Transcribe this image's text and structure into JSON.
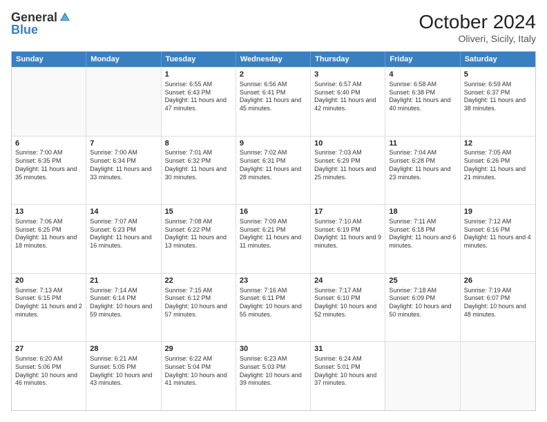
{
  "header": {
    "logo_general": "General",
    "logo_blue": "Blue",
    "month_title": "October 2024",
    "location": "Oliveri, Sicily, Italy"
  },
  "weekdays": [
    "Sunday",
    "Monday",
    "Tuesday",
    "Wednesday",
    "Thursday",
    "Friday",
    "Saturday"
  ],
  "weeks": [
    [
      {
        "day": "",
        "sunrise": "",
        "sunset": "",
        "daylight": ""
      },
      {
        "day": "",
        "sunrise": "",
        "sunset": "",
        "daylight": ""
      },
      {
        "day": "1",
        "sunrise": "Sunrise: 6:55 AM",
        "sunset": "Sunset: 6:43 PM",
        "daylight": "Daylight: 11 hours and 47 minutes."
      },
      {
        "day": "2",
        "sunrise": "Sunrise: 6:56 AM",
        "sunset": "Sunset: 6:41 PM",
        "daylight": "Daylight: 11 hours and 45 minutes."
      },
      {
        "day": "3",
        "sunrise": "Sunrise: 6:57 AM",
        "sunset": "Sunset: 6:40 PM",
        "daylight": "Daylight: 11 hours and 42 minutes."
      },
      {
        "day": "4",
        "sunrise": "Sunrise: 6:58 AM",
        "sunset": "Sunset: 6:38 PM",
        "daylight": "Daylight: 11 hours and 40 minutes."
      },
      {
        "day": "5",
        "sunrise": "Sunrise: 6:59 AM",
        "sunset": "Sunset: 6:37 PM",
        "daylight": "Daylight: 11 hours and 38 minutes."
      }
    ],
    [
      {
        "day": "6",
        "sunrise": "Sunrise: 7:00 AM",
        "sunset": "Sunset: 6:35 PM",
        "daylight": "Daylight: 11 hours and 35 minutes."
      },
      {
        "day": "7",
        "sunrise": "Sunrise: 7:00 AM",
        "sunset": "Sunset: 6:34 PM",
        "daylight": "Daylight: 11 hours and 33 minutes."
      },
      {
        "day": "8",
        "sunrise": "Sunrise: 7:01 AM",
        "sunset": "Sunset: 6:32 PM",
        "daylight": "Daylight: 11 hours and 30 minutes."
      },
      {
        "day": "9",
        "sunrise": "Sunrise: 7:02 AM",
        "sunset": "Sunset: 6:31 PM",
        "daylight": "Daylight: 11 hours and 28 minutes."
      },
      {
        "day": "10",
        "sunrise": "Sunrise: 7:03 AM",
        "sunset": "Sunset: 6:29 PM",
        "daylight": "Daylight: 11 hours and 25 minutes."
      },
      {
        "day": "11",
        "sunrise": "Sunrise: 7:04 AM",
        "sunset": "Sunset: 6:28 PM",
        "daylight": "Daylight: 11 hours and 23 minutes."
      },
      {
        "day": "12",
        "sunrise": "Sunrise: 7:05 AM",
        "sunset": "Sunset: 6:26 PM",
        "daylight": "Daylight: 11 hours and 21 minutes."
      }
    ],
    [
      {
        "day": "13",
        "sunrise": "Sunrise: 7:06 AM",
        "sunset": "Sunset: 6:25 PM",
        "daylight": "Daylight: 11 hours and 18 minutes."
      },
      {
        "day": "14",
        "sunrise": "Sunrise: 7:07 AM",
        "sunset": "Sunset: 6:23 PM",
        "daylight": "Daylight: 11 hours and 16 minutes."
      },
      {
        "day": "15",
        "sunrise": "Sunrise: 7:08 AM",
        "sunset": "Sunset: 6:22 PM",
        "daylight": "Daylight: 11 hours and 13 minutes."
      },
      {
        "day": "16",
        "sunrise": "Sunrise: 7:09 AM",
        "sunset": "Sunset: 6:21 PM",
        "daylight": "Daylight: 11 hours and 11 minutes."
      },
      {
        "day": "17",
        "sunrise": "Sunrise: 7:10 AM",
        "sunset": "Sunset: 6:19 PM",
        "daylight": "Daylight: 11 hours and 9 minutes."
      },
      {
        "day": "18",
        "sunrise": "Sunrise: 7:11 AM",
        "sunset": "Sunset: 6:18 PM",
        "daylight": "Daylight: 11 hours and 6 minutes."
      },
      {
        "day": "19",
        "sunrise": "Sunrise: 7:12 AM",
        "sunset": "Sunset: 6:16 PM",
        "daylight": "Daylight: 11 hours and 4 minutes."
      }
    ],
    [
      {
        "day": "20",
        "sunrise": "Sunrise: 7:13 AM",
        "sunset": "Sunset: 6:15 PM",
        "daylight": "Daylight: 11 hours and 2 minutes."
      },
      {
        "day": "21",
        "sunrise": "Sunrise: 7:14 AM",
        "sunset": "Sunset: 6:14 PM",
        "daylight": "Daylight: 10 hours and 59 minutes."
      },
      {
        "day": "22",
        "sunrise": "Sunrise: 7:15 AM",
        "sunset": "Sunset: 6:12 PM",
        "daylight": "Daylight: 10 hours and 57 minutes."
      },
      {
        "day": "23",
        "sunrise": "Sunrise: 7:16 AM",
        "sunset": "Sunset: 6:11 PM",
        "daylight": "Daylight: 10 hours and 55 minutes."
      },
      {
        "day": "24",
        "sunrise": "Sunrise: 7:17 AM",
        "sunset": "Sunset: 6:10 PM",
        "daylight": "Daylight: 10 hours and 52 minutes."
      },
      {
        "day": "25",
        "sunrise": "Sunrise: 7:18 AM",
        "sunset": "Sunset: 6:09 PM",
        "daylight": "Daylight: 10 hours and 50 minutes."
      },
      {
        "day": "26",
        "sunrise": "Sunrise: 7:19 AM",
        "sunset": "Sunset: 6:07 PM",
        "daylight": "Daylight: 10 hours and 48 minutes."
      }
    ],
    [
      {
        "day": "27",
        "sunrise": "Sunrise: 6:20 AM",
        "sunset": "Sunset: 5:06 PM",
        "daylight": "Daylight: 10 hours and 46 minutes."
      },
      {
        "day": "28",
        "sunrise": "Sunrise: 6:21 AM",
        "sunset": "Sunset: 5:05 PM",
        "daylight": "Daylight: 10 hours and 43 minutes."
      },
      {
        "day": "29",
        "sunrise": "Sunrise: 6:22 AM",
        "sunset": "Sunset: 5:04 PM",
        "daylight": "Daylight: 10 hours and 41 minutes."
      },
      {
        "day": "30",
        "sunrise": "Sunrise: 6:23 AM",
        "sunset": "Sunset: 5:03 PM",
        "daylight": "Daylight: 10 hours and 39 minutes."
      },
      {
        "day": "31",
        "sunrise": "Sunrise: 6:24 AM",
        "sunset": "Sunset: 5:01 PM",
        "daylight": "Daylight: 10 hours and 37 minutes."
      },
      {
        "day": "",
        "sunrise": "",
        "sunset": "",
        "daylight": ""
      },
      {
        "day": "",
        "sunrise": "",
        "sunset": "",
        "daylight": ""
      }
    ]
  ]
}
